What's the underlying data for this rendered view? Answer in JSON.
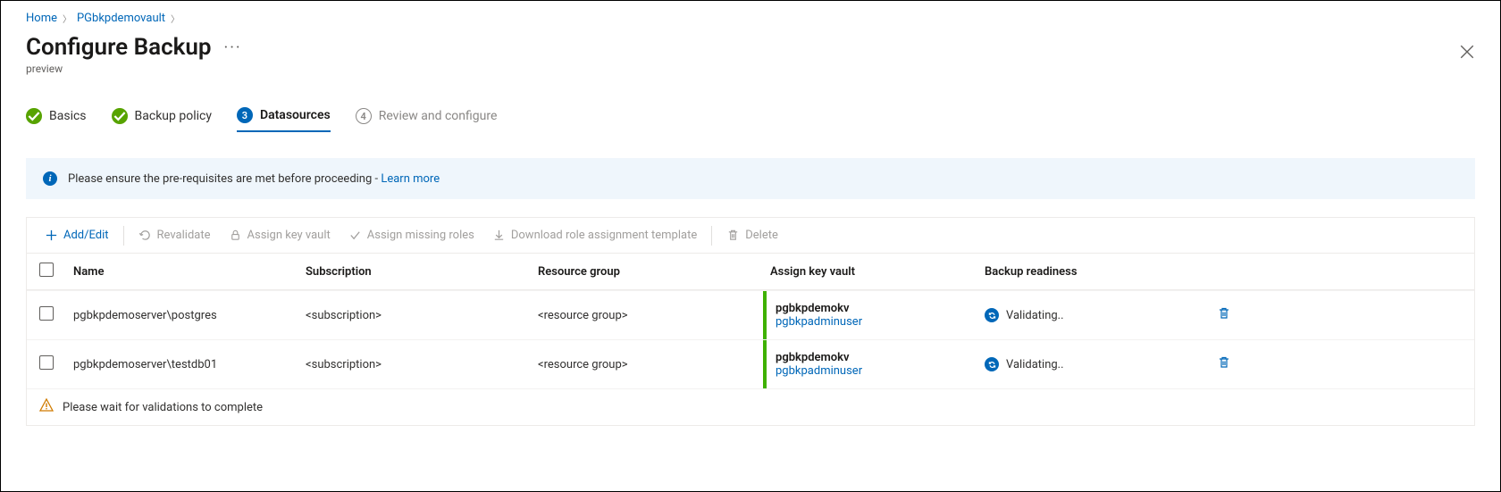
{
  "breadcrumb": {
    "home": "Home",
    "vault": "PGbkpdemovault"
  },
  "header": {
    "title": "Configure Backup",
    "subtitle": "preview"
  },
  "stepper": {
    "s1": {
      "label": "Basics"
    },
    "s2": {
      "label": "Backup policy"
    },
    "s3": {
      "num": "3",
      "label": "Datasources"
    },
    "s4": {
      "num": "4",
      "label": "Review and configure"
    }
  },
  "info": {
    "text": "Please ensure the pre-requisites are met before proceeding - ",
    "link": "Learn more"
  },
  "toolbar": {
    "add": "Add/Edit",
    "revalidate": "Revalidate",
    "assignkv": "Assign key vault",
    "assignroles": "Assign missing roles",
    "download": "Download role assignment template",
    "delete": "Delete"
  },
  "columns": {
    "name": "Name",
    "sub": "Subscription",
    "rg": "Resource group",
    "kv": "Assign key vault",
    "readiness": "Backup readiness"
  },
  "rows": [
    {
      "name": "pgbkpdemoserver\\postgres",
      "sub": "<subscription>",
      "rg": "<resource group>",
      "kv": "pgbkpdemokv",
      "secret": "pgbkpadminuser",
      "status": "Validating.."
    },
    {
      "name": "pgbkpdemoserver\\testdb01",
      "sub": "<subscription>",
      "rg": "<resource group>",
      "kv": "pgbkpdemokv",
      "secret": "pgbkpadminuser",
      "status": "Validating.."
    }
  ],
  "footer": {
    "msg": "Please wait for validations to complete"
  }
}
